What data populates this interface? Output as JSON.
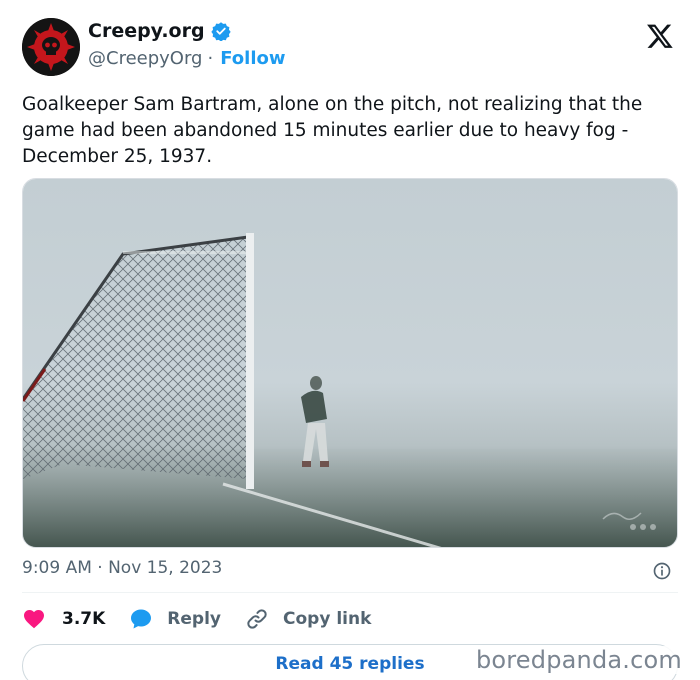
{
  "post": {
    "display_name": "Creepy.org",
    "handle": "@CreepyOrg",
    "separator": "·",
    "follow_label": "Follow",
    "text": "Goalkeeper Sam Bartram, alone on the pitch, not realizing that the game had been abandoned 15 minutes earlier due to heavy fog - December 25, 1937.",
    "timestamp": "9:09 AM · Nov 15, 2023",
    "icons": {
      "avatar": "skull-logo-icon",
      "verified": "verified-badge-icon",
      "platform": "x-logo-icon",
      "info": "info-icon",
      "like": "heart-icon",
      "reply": "speech-bubble-icon",
      "copy": "link-icon"
    }
  },
  "actions": {
    "like_count": "3.7K",
    "reply_label": "Reply",
    "copy_link_label": "Copy link"
  },
  "replies_button": "Read 45 replies",
  "watermark": "boredpanda.com",
  "colors": {
    "accent": "#1d9bf0",
    "like": "#f91880",
    "text": "#0f1419",
    "muted": "#536471"
  }
}
